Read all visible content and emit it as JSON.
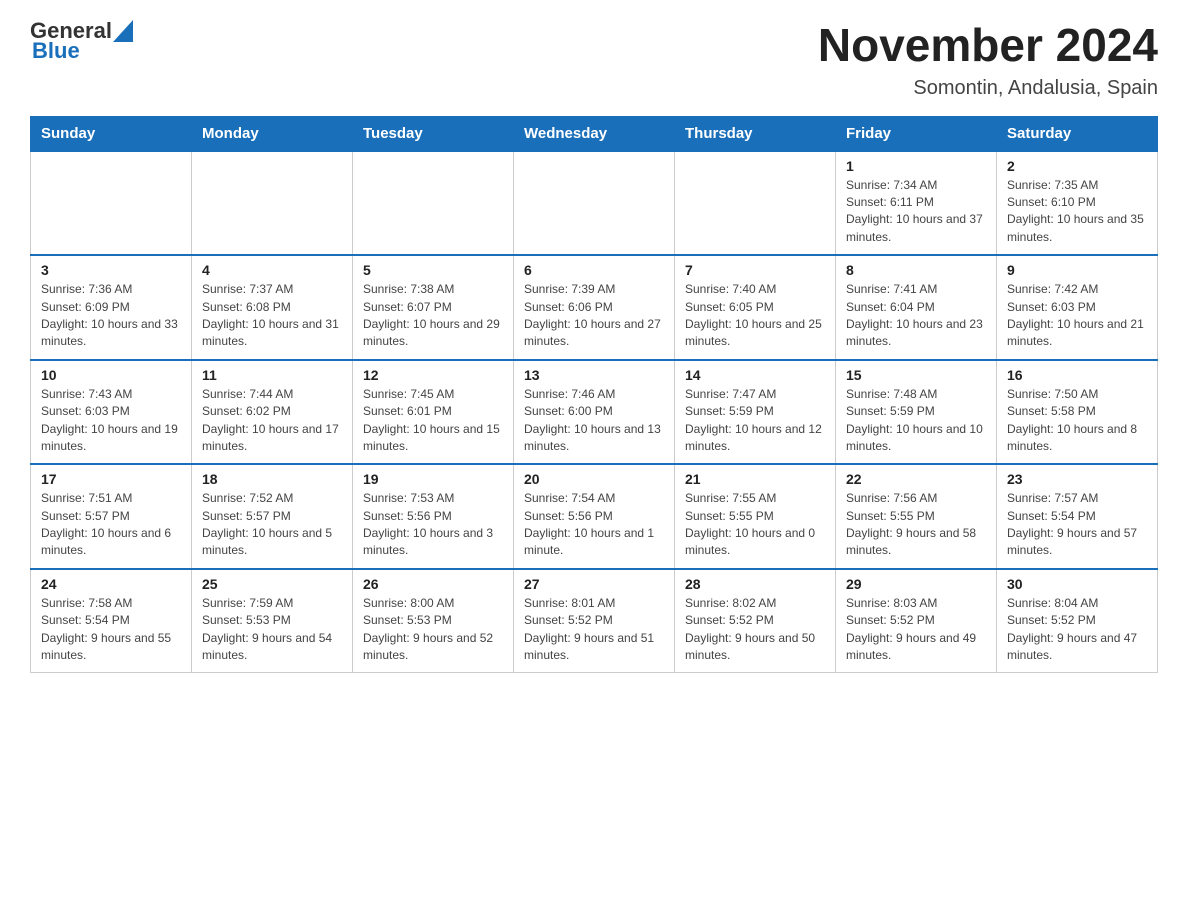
{
  "logo": {
    "general": "General",
    "blue": "Blue"
  },
  "title": "November 2024",
  "subtitle": "Somontin, Andalusia, Spain",
  "days_of_week": [
    "Sunday",
    "Monday",
    "Tuesday",
    "Wednesday",
    "Thursday",
    "Friday",
    "Saturday"
  ],
  "weeks": [
    [
      {
        "day": "",
        "info": ""
      },
      {
        "day": "",
        "info": ""
      },
      {
        "day": "",
        "info": ""
      },
      {
        "day": "",
        "info": ""
      },
      {
        "day": "",
        "info": ""
      },
      {
        "day": "1",
        "info": "Sunrise: 7:34 AM\nSunset: 6:11 PM\nDaylight: 10 hours and 37 minutes."
      },
      {
        "day": "2",
        "info": "Sunrise: 7:35 AM\nSunset: 6:10 PM\nDaylight: 10 hours and 35 minutes."
      }
    ],
    [
      {
        "day": "3",
        "info": "Sunrise: 7:36 AM\nSunset: 6:09 PM\nDaylight: 10 hours and 33 minutes."
      },
      {
        "day": "4",
        "info": "Sunrise: 7:37 AM\nSunset: 6:08 PM\nDaylight: 10 hours and 31 minutes."
      },
      {
        "day": "5",
        "info": "Sunrise: 7:38 AM\nSunset: 6:07 PM\nDaylight: 10 hours and 29 minutes."
      },
      {
        "day": "6",
        "info": "Sunrise: 7:39 AM\nSunset: 6:06 PM\nDaylight: 10 hours and 27 minutes."
      },
      {
        "day": "7",
        "info": "Sunrise: 7:40 AM\nSunset: 6:05 PM\nDaylight: 10 hours and 25 minutes."
      },
      {
        "day": "8",
        "info": "Sunrise: 7:41 AM\nSunset: 6:04 PM\nDaylight: 10 hours and 23 minutes."
      },
      {
        "day": "9",
        "info": "Sunrise: 7:42 AM\nSunset: 6:03 PM\nDaylight: 10 hours and 21 minutes."
      }
    ],
    [
      {
        "day": "10",
        "info": "Sunrise: 7:43 AM\nSunset: 6:03 PM\nDaylight: 10 hours and 19 minutes."
      },
      {
        "day": "11",
        "info": "Sunrise: 7:44 AM\nSunset: 6:02 PM\nDaylight: 10 hours and 17 minutes."
      },
      {
        "day": "12",
        "info": "Sunrise: 7:45 AM\nSunset: 6:01 PM\nDaylight: 10 hours and 15 minutes."
      },
      {
        "day": "13",
        "info": "Sunrise: 7:46 AM\nSunset: 6:00 PM\nDaylight: 10 hours and 13 minutes."
      },
      {
        "day": "14",
        "info": "Sunrise: 7:47 AM\nSunset: 5:59 PM\nDaylight: 10 hours and 12 minutes."
      },
      {
        "day": "15",
        "info": "Sunrise: 7:48 AM\nSunset: 5:59 PM\nDaylight: 10 hours and 10 minutes."
      },
      {
        "day": "16",
        "info": "Sunrise: 7:50 AM\nSunset: 5:58 PM\nDaylight: 10 hours and 8 minutes."
      }
    ],
    [
      {
        "day": "17",
        "info": "Sunrise: 7:51 AM\nSunset: 5:57 PM\nDaylight: 10 hours and 6 minutes."
      },
      {
        "day": "18",
        "info": "Sunrise: 7:52 AM\nSunset: 5:57 PM\nDaylight: 10 hours and 5 minutes."
      },
      {
        "day": "19",
        "info": "Sunrise: 7:53 AM\nSunset: 5:56 PM\nDaylight: 10 hours and 3 minutes."
      },
      {
        "day": "20",
        "info": "Sunrise: 7:54 AM\nSunset: 5:56 PM\nDaylight: 10 hours and 1 minute."
      },
      {
        "day": "21",
        "info": "Sunrise: 7:55 AM\nSunset: 5:55 PM\nDaylight: 10 hours and 0 minutes."
      },
      {
        "day": "22",
        "info": "Sunrise: 7:56 AM\nSunset: 5:55 PM\nDaylight: 9 hours and 58 minutes."
      },
      {
        "day": "23",
        "info": "Sunrise: 7:57 AM\nSunset: 5:54 PM\nDaylight: 9 hours and 57 minutes."
      }
    ],
    [
      {
        "day": "24",
        "info": "Sunrise: 7:58 AM\nSunset: 5:54 PM\nDaylight: 9 hours and 55 minutes."
      },
      {
        "day": "25",
        "info": "Sunrise: 7:59 AM\nSunset: 5:53 PM\nDaylight: 9 hours and 54 minutes."
      },
      {
        "day": "26",
        "info": "Sunrise: 8:00 AM\nSunset: 5:53 PM\nDaylight: 9 hours and 52 minutes."
      },
      {
        "day": "27",
        "info": "Sunrise: 8:01 AM\nSunset: 5:52 PM\nDaylight: 9 hours and 51 minutes."
      },
      {
        "day": "28",
        "info": "Sunrise: 8:02 AM\nSunset: 5:52 PM\nDaylight: 9 hours and 50 minutes."
      },
      {
        "day": "29",
        "info": "Sunrise: 8:03 AM\nSunset: 5:52 PM\nDaylight: 9 hours and 49 minutes."
      },
      {
        "day": "30",
        "info": "Sunrise: 8:04 AM\nSunset: 5:52 PM\nDaylight: 9 hours and 47 minutes."
      }
    ]
  ]
}
